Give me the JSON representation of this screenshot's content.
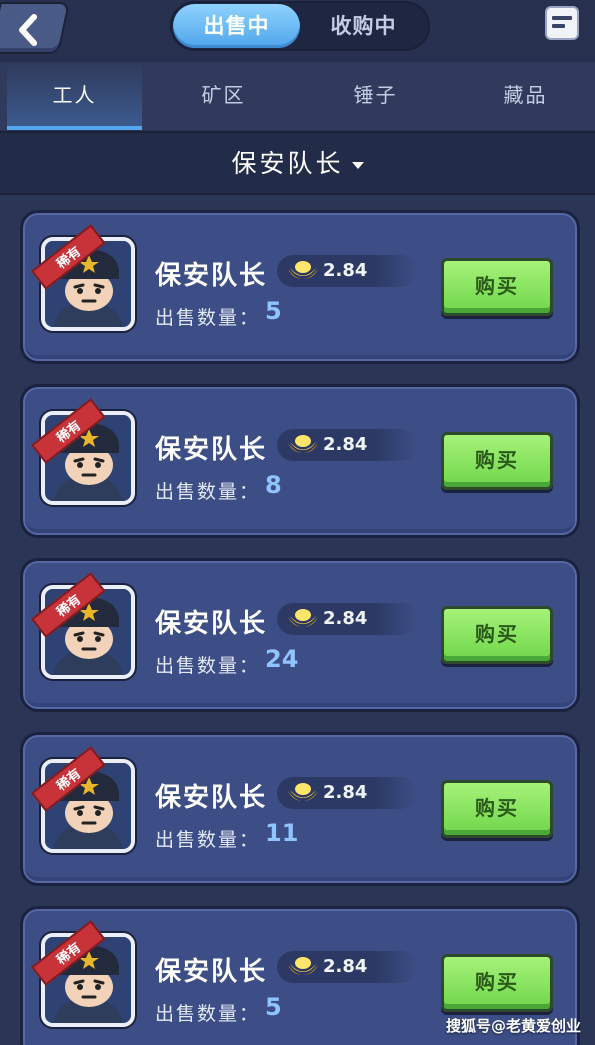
{
  "header": {
    "tabs": [
      {
        "label": "出售中"
      },
      {
        "label": "收购中"
      }
    ]
  },
  "categories": [
    {
      "label": "工人"
    },
    {
      "label": "矿区"
    },
    {
      "label": "锤子"
    },
    {
      "label": "藏品"
    }
  ],
  "filter": {
    "selected": "保安队长"
  },
  "listings": [
    {
      "rarity": "稀有",
      "name": "保安队长",
      "price": "2.84",
      "qty_label": "出售数量：",
      "qty": "5",
      "buy_label": "购买"
    },
    {
      "rarity": "稀有",
      "name": "保安队长",
      "price": "2.84",
      "qty_label": "出售数量：",
      "qty": "8",
      "buy_label": "购买"
    },
    {
      "rarity": "稀有",
      "name": "保安队长",
      "price": "2.84",
      "qty_label": "出售数量：",
      "qty": "24",
      "buy_label": "购买"
    },
    {
      "rarity": "稀有",
      "name": "保安队长",
      "price": "2.84",
      "qty_label": "出售数量：",
      "qty": "11",
      "buy_label": "购买"
    },
    {
      "rarity": "稀有",
      "name": "保安队长",
      "price": "2.84",
      "qty_label": "出售数量：",
      "qty": "5",
      "buy_label": "购买"
    }
  ],
  "watermark": "搜狐号@老黄爱创业",
  "colors": {
    "background": "#2b3656",
    "card": "#3d4e86",
    "tab_active": "#56a8ee",
    "buy_button": "#8ee566",
    "rarity_ribbon": "#c8333a",
    "quantity": "#8fc4ff"
  },
  "icons": [
    "back-arrow-icon",
    "menu-icon",
    "gold-ingot-icon",
    "dropdown-caret-icon",
    "security-captain-avatar"
  ]
}
